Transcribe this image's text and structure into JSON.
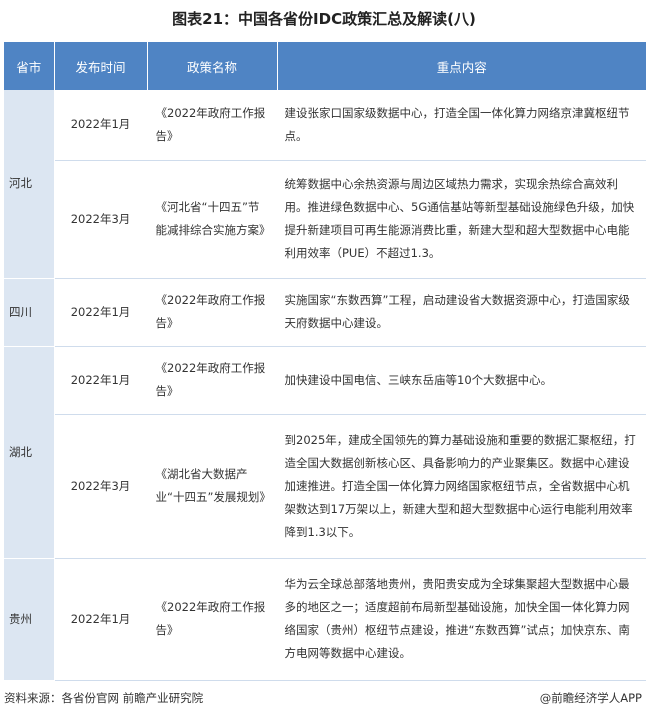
{
  "title": "图表21：中国各省份IDC政策汇总及解读(八)",
  "table": {
    "headers": [
      "省市",
      "发布时间",
      "政策名称",
      "重点内容"
    ],
    "provinces": [
      "河北",
      "四川",
      "湖北",
      "贵州"
    ],
    "rows": [
      {
        "date": "2022年1月",
        "name": "《2022年政府工作报告》",
        "point": "建设张家口国家级数据中心，打造全国一体化算力网络京津冀枢纽节点。"
      },
      {
        "date": "2022年3月",
        "name": "《河北省“十四五”节能减排综合实施方案》",
        "point": "统筹数据中心余热资源与周边区域热力需求，实现余热综合高效利用。推进绿色数据中心、5G通信基站等新型基础设施绿色升级，加快提升新建项目可再生能源消费比重，新建大型和超大型数据中心电能利用效率（PUE）不超过1.3。"
      },
      {
        "date": "2022年1月",
        "name": "《2022年政府工作报告》",
        "point": "实施国家“东数西算”工程，启动建设省大数据资源中心，打造国家级天府数据中心建设。"
      },
      {
        "date": "2022年1月",
        "name": "《2022年政府工作报告》",
        "point": "加快建设中国电信、三峡东岳庙等10个大数据中心。"
      },
      {
        "date": "2022年3月",
        "name": "《湖北省大数据产业“十四五”发展规划》",
        "point": "到2025年，建成全国领先的算力基础设施和重要的数据汇聚枢纽，打造全国大数据创新核心区、具备影响力的产业聚集区。数据中心建设加速推进。打造全国一体化算力网络国家枢纽节点，全省数据中心机架数达到17万架以上，新建大型和超大型数据中心运行电能利用效率降到1.3以下。"
      },
      {
        "date": "2022年1月",
        "name": "《2022年政府工作报告》",
        "point": "华为云全球总部落地贵州，贵阳贵安成为全球集聚超大型数据中心最多的地区之一；适度超前布局新型基础设施，加快全国一体化算力网络国家（贵州）枢纽节点建设，推进“东数西算”试点；加快京东、南方电网等数据中心建设。"
      }
    ]
  },
  "footer": {
    "source": "资料来源：各省份官网 前瞻产业研究院",
    "brand": "@前瞻经济学人APP"
  }
}
